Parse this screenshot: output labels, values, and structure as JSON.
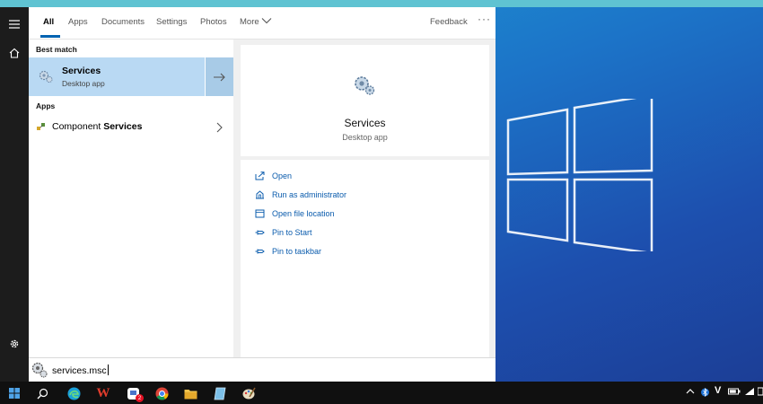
{
  "tabs": [
    {
      "label": "All",
      "active": true
    },
    {
      "label": "Apps"
    },
    {
      "label": "Documents"
    },
    {
      "label": "Settings"
    },
    {
      "label": "Photos"
    },
    {
      "label": "More"
    }
  ],
  "feedback_label": "Feedback",
  "more_options": "···",
  "results": {
    "best_match_heading": "Best match",
    "best_match": {
      "title": "Services",
      "subtitle": "Desktop app",
      "icon": "services-gears-icon"
    },
    "apps_heading": "Apps",
    "apps": [
      {
        "prefix": "Component ",
        "highlight": "Services",
        "icon": "component-services-icon"
      }
    ]
  },
  "detail": {
    "title": "Services",
    "subtitle": "Desktop app",
    "actions": [
      {
        "label": "Open",
        "icon": "open-icon"
      },
      {
        "label": "Run as administrator",
        "icon": "run-as-admin-icon"
      },
      {
        "label": "Open file location",
        "icon": "folder-icon"
      },
      {
        "label": "Pin to Start",
        "icon": "pin-icon"
      },
      {
        "label": "Pin to taskbar",
        "icon": "pin-icon"
      }
    ]
  },
  "search": {
    "value": "services.msc"
  },
  "taskbar": {
    "apps": [
      "start-icon",
      "search-icon",
      "edge-icon",
      "wps-writer-icon",
      "mail-app-icon",
      "chrome-icon",
      "file-explorer-icon",
      "notepad-icon",
      "paint-icon"
    ],
    "word_app_letter": "W",
    "mail_badge": "2",
    "tray_letter": "V"
  },
  "colors": {
    "accent": "#0063b1",
    "selection": "#b9d9f3",
    "link": "#0b5cad",
    "taskbar": "#101010"
  }
}
